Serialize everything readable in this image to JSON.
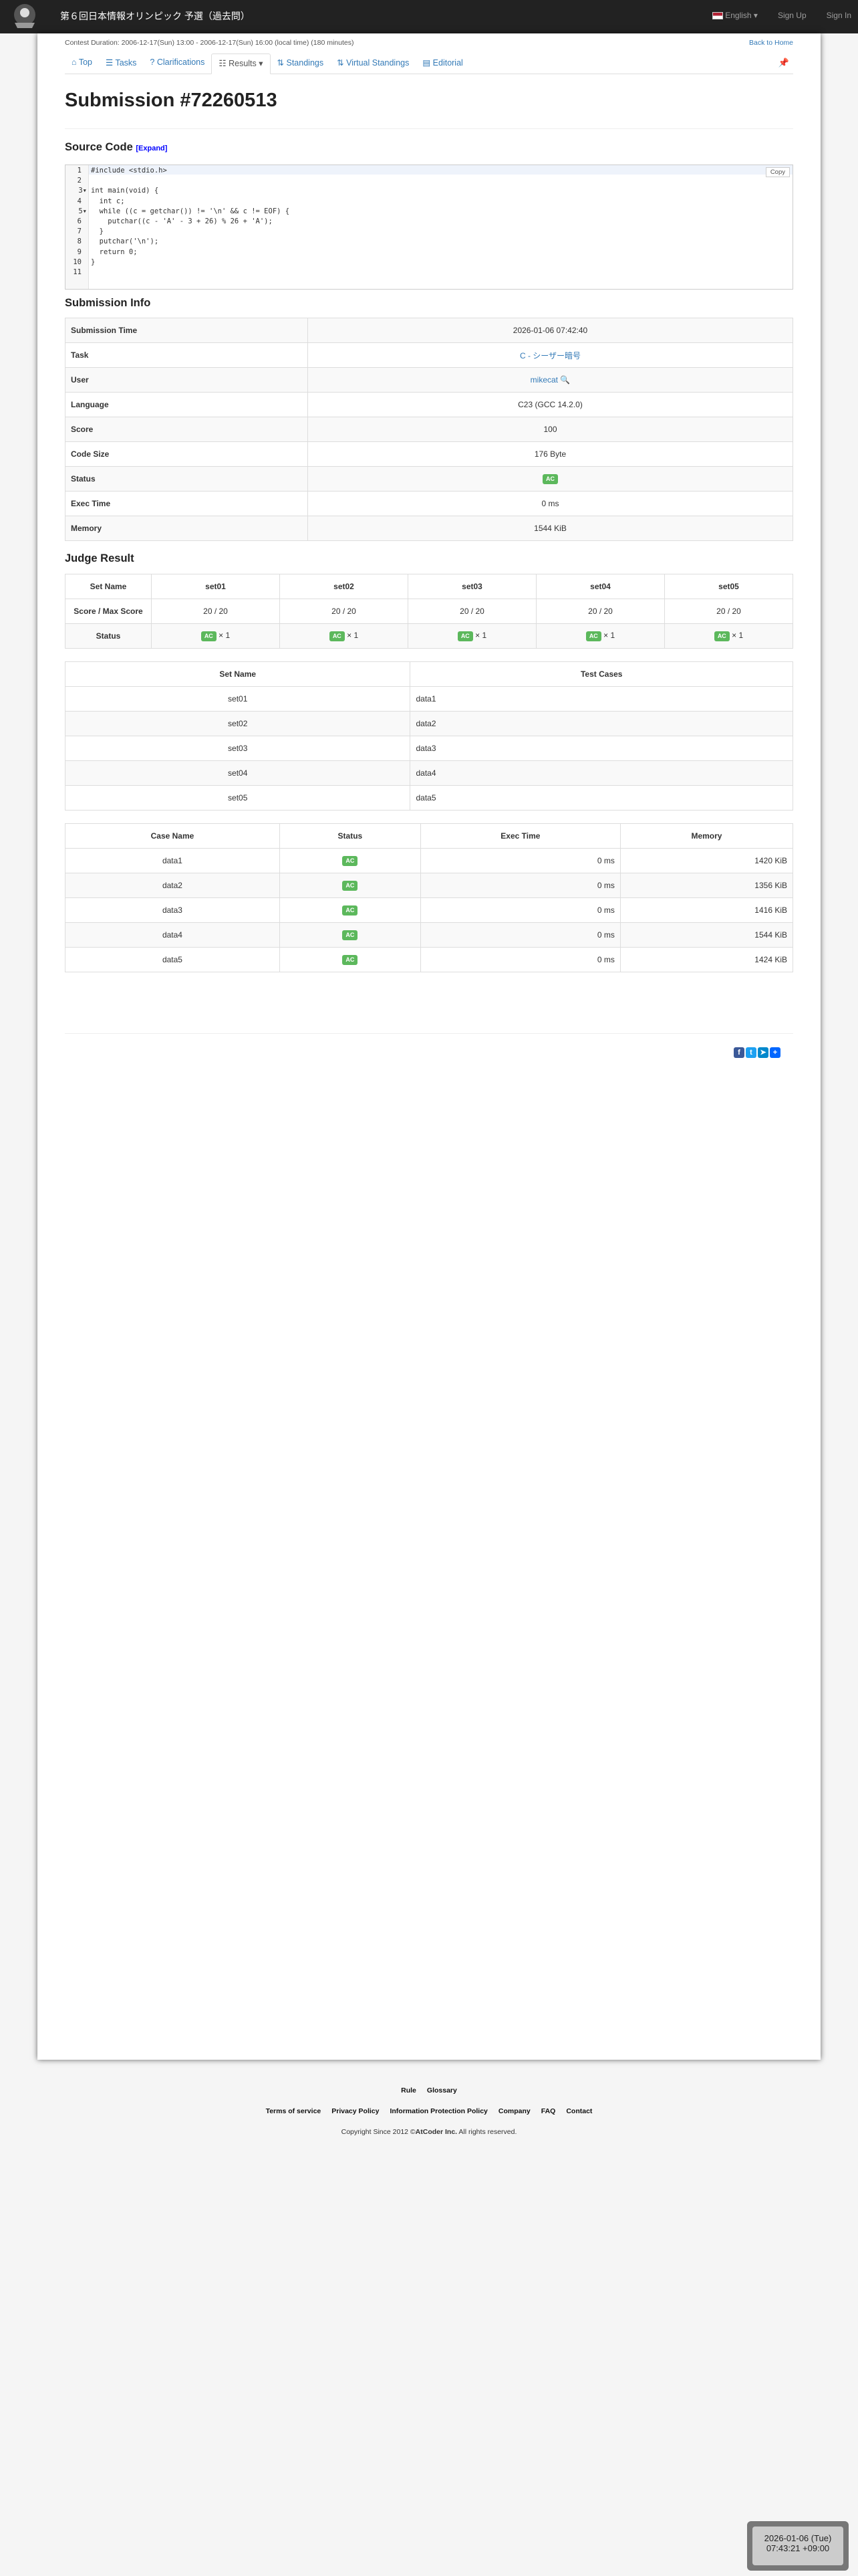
{
  "site_title": "第６回日本情報オリンピック 予選（過去問）",
  "nav": {
    "language": "English",
    "signup": "Sign Up",
    "signin": "Sign In"
  },
  "contest": {
    "duration": "Contest Duration: 2006-12-17(Sun) 13:00 - 2006-12-17(Sun) 16:00 (local time) (180 minutes)",
    "back_home": "Back to Home"
  },
  "tabs": [
    "Top",
    "Tasks",
    "Clarifications",
    "Results",
    "Standings",
    "Virtual Standings",
    "Editorial"
  ],
  "title": "Submission #72260513",
  "source": {
    "heading": "Source Code",
    "expand": "[Expand]",
    "copy": "Copy",
    "lines": [
      "#include <stdio.h>",
      "",
      "int main(void) {",
      "  int c;",
      "  while ((c = getchar()) != '\\n' && c != EOF) {",
      "    putchar((c - 'A' - 3 + 26) % 26 + 'A');",
      "  }",
      "  putchar('\\n');",
      "  return 0;",
      "}",
      ""
    ]
  },
  "info": {
    "heading": "Submission Info",
    "rows": [
      [
        "Submission Time",
        "2026-01-06 07:42:40"
      ],
      [
        "Task",
        "C - シーザー暗号"
      ],
      [
        "User",
        "mikecat"
      ],
      [
        "Language",
        "C23 (GCC 14.2.0)"
      ],
      [
        "Score",
        "100"
      ],
      [
        "Code Size",
        "176 Byte"
      ],
      [
        "Status",
        "AC"
      ],
      [
        "Exec Time",
        "0 ms"
      ],
      [
        "Memory",
        "1544 KiB"
      ]
    ]
  },
  "judge": {
    "heading": "Judge Result",
    "header": [
      "Set Name",
      "set01",
      "set02",
      "set03",
      "set04",
      "set05"
    ],
    "score_label": "Score / Max Score",
    "scores": [
      "20 / 20",
      "20 / 20",
      "20 / 20",
      "20 / 20",
      "20 / 20"
    ],
    "status_label": "Status",
    "status_badge": "AC",
    "status_count": "× 1"
  },
  "testcases": {
    "header": [
      "Set Name",
      "Test Cases"
    ],
    "rows": [
      [
        "set01",
        "data1"
      ],
      [
        "set02",
        "data2"
      ],
      [
        "set03",
        "data3"
      ],
      [
        "set04",
        "data4"
      ],
      [
        "set05",
        "data5"
      ]
    ]
  },
  "cases": {
    "header": [
      "Case Name",
      "Status",
      "Exec Time",
      "Memory"
    ],
    "rows": [
      [
        "data1",
        "AC",
        "0 ms",
        "1420 KiB"
      ],
      [
        "data2",
        "AC",
        "0 ms",
        "1356 KiB"
      ],
      [
        "data3",
        "AC",
        "0 ms",
        "1416 KiB"
      ],
      [
        "data4",
        "AC",
        "0 ms",
        "1544 KiB"
      ],
      [
        "data5",
        "AC",
        "0 ms",
        "1424 KiB"
      ]
    ]
  },
  "footer": {
    "row1": [
      "Rule",
      "Glossary"
    ],
    "row2": [
      "Terms of service",
      "Privacy Policy",
      "Information Protection Policy",
      "Company",
      "FAQ",
      "Contact"
    ],
    "copyright_pre": "Copyright Since 2012 ©",
    "copyright_brand": "AtCoder Inc.",
    "copyright_post": " All rights reserved."
  },
  "clock": {
    "date": "2026-01-06 (Tue)",
    "time": "07:43:21 +09:00"
  },
  "colors": {
    "navbar": "#222222",
    "link": "#337ab7",
    "ac": "#5cb85c"
  }
}
